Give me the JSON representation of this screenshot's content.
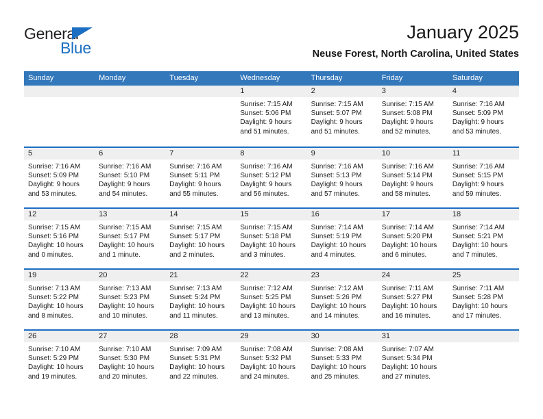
{
  "brand": {
    "word_one": "General",
    "word_two": "Blue",
    "accent_color": "#1b6ec2"
  },
  "header": {
    "title": "January 2025",
    "location": "Neuse Forest, North Carolina, United States"
  },
  "calendar": {
    "header_bg": "#3478bc",
    "weekdays": [
      "Sunday",
      "Monday",
      "Tuesday",
      "Wednesday",
      "Thursday",
      "Friday",
      "Saturday"
    ],
    "weeks": [
      [
        {
          "day": "",
          "empty": true,
          "sunrise": "",
          "sunset": "",
          "daylight_line1": "",
          "daylight_line2": ""
        },
        {
          "day": "",
          "empty": true,
          "sunrise": "",
          "sunset": "",
          "daylight_line1": "",
          "daylight_line2": ""
        },
        {
          "day": "",
          "empty": true,
          "sunrise": "",
          "sunset": "",
          "daylight_line1": "",
          "daylight_line2": ""
        },
        {
          "day": "1",
          "sunrise": "Sunrise: 7:15 AM",
          "sunset": "Sunset: 5:06 PM",
          "daylight_line1": "Daylight: 9 hours",
          "daylight_line2": "and 51 minutes."
        },
        {
          "day": "2",
          "sunrise": "Sunrise: 7:15 AM",
          "sunset": "Sunset: 5:07 PM",
          "daylight_line1": "Daylight: 9 hours",
          "daylight_line2": "and 51 minutes."
        },
        {
          "day": "3",
          "sunrise": "Sunrise: 7:15 AM",
          "sunset": "Sunset: 5:08 PM",
          "daylight_line1": "Daylight: 9 hours",
          "daylight_line2": "and 52 minutes."
        },
        {
          "day": "4",
          "sunrise": "Sunrise: 7:16 AM",
          "sunset": "Sunset: 5:09 PM",
          "daylight_line1": "Daylight: 9 hours",
          "daylight_line2": "and 53 minutes."
        }
      ],
      [
        {
          "day": "5",
          "sunrise": "Sunrise: 7:16 AM",
          "sunset": "Sunset: 5:09 PM",
          "daylight_line1": "Daylight: 9 hours",
          "daylight_line2": "and 53 minutes."
        },
        {
          "day": "6",
          "sunrise": "Sunrise: 7:16 AM",
          "sunset": "Sunset: 5:10 PM",
          "daylight_line1": "Daylight: 9 hours",
          "daylight_line2": "and 54 minutes."
        },
        {
          "day": "7",
          "sunrise": "Sunrise: 7:16 AM",
          "sunset": "Sunset: 5:11 PM",
          "daylight_line1": "Daylight: 9 hours",
          "daylight_line2": "and 55 minutes."
        },
        {
          "day": "8",
          "sunrise": "Sunrise: 7:16 AM",
          "sunset": "Sunset: 5:12 PM",
          "daylight_line1": "Daylight: 9 hours",
          "daylight_line2": "and 56 minutes."
        },
        {
          "day": "9",
          "sunrise": "Sunrise: 7:16 AM",
          "sunset": "Sunset: 5:13 PM",
          "daylight_line1": "Daylight: 9 hours",
          "daylight_line2": "and 57 minutes."
        },
        {
          "day": "10",
          "sunrise": "Sunrise: 7:16 AM",
          "sunset": "Sunset: 5:14 PM",
          "daylight_line1": "Daylight: 9 hours",
          "daylight_line2": "and 58 minutes."
        },
        {
          "day": "11",
          "sunrise": "Sunrise: 7:16 AM",
          "sunset": "Sunset: 5:15 PM",
          "daylight_line1": "Daylight: 9 hours",
          "daylight_line2": "and 59 minutes."
        }
      ],
      [
        {
          "day": "12",
          "sunrise": "Sunrise: 7:15 AM",
          "sunset": "Sunset: 5:16 PM",
          "daylight_line1": "Daylight: 10 hours",
          "daylight_line2": "and 0 minutes."
        },
        {
          "day": "13",
          "sunrise": "Sunrise: 7:15 AM",
          "sunset": "Sunset: 5:17 PM",
          "daylight_line1": "Daylight: 10 hours",
          "daylight_line2": "and 1 minute."
        },
        {
          "day": "14",
          "sunrise": "Sunrise: 7:15 AM",
          "sunset": "Sunset: 5:17 PM",
          "daylight_line1": "Daylight: 10 hours",
          "daylight_line2": "and 2 minutes."
        },
        {
          "day": "15",
          "sunrise": "Sunrise: 7:15 AM",
          "sunset": "Sunset: 5:18 PM",
          "daylight_line1": "Daylight: 10 hours",
          "daylight_line2": "and 3 minutes."
        },
        {
          "day": "16",
          "sunrise": "Sunrise: 7:14 AM",
          "sunset": "Sunset: 5:19 PM",
          "daylight_line1": "Daylight: 10 hours",
          "daylight_line2": "and 4 minutes."
        },
        {
          "day": "17",
          "sunrise": "Sunrise: 7:14 AM",
          "sunset": "Sunset: 5:20 PM",
          "daylight_line1": "Daylight: 10 hours",
          "daylight_line2": "and 6 minutes."
        },
        {
          "day": "18",
          "sunrise": "Sunrise: 7:14 AM",
          "sunset": "Sunset: 5:21 PM",
          "daylight_line1": "Daylight: 10 hours",
          "daylight_line2": "and 7 minutes."
        }
      ],
      [
        {
          "day": "19",
          "sunrise": "Sunrise: 7:13 AM",
          "sunset": "Sunset: 5:22 PM",
          "daylight_line1": "Daylight: 10 hours",
          "daylight_line2": "and 8 minutes."
        },
        {
          "day": "20",
          "sunrise": "Sunrise: 7:13 AM",
          "sunset": "Sunset: 5:23 PM",
          "daylight_line1": "Daylight: 10 hours",
          "daylight_line2": "and 10 minutes."
        },
        {
          "day": "21",
          "sunrise": "Sunrise: 7:13 AM",
          "sunset": "Sunset: 5:24 PM",
          "daylight_line1": "Daylight: 10 hours",
          "daylight_line2": "and 11 minutes."
        },
        {
          "day": "22",
          "sunrise": "Sunrise: 7:12 AM",
          "sunset": "Sunset: 5:25 PM",
          "daylight_line1": "Daylight: 10 hours",
          "daylight_line2": "and 13 minutes."
        },
        {
          "day": "23",
          "sunrise": "Sunrise: 7:12 AM",
          "sunset": "Sunset: 5:26 PM",
          "daylight_line1": "Daylight: 10 hours",
          "daylight_line2": "and 14 minutes."
        },
        {
          "day": "24",
          "sunrise": "Sunrise: 7:11 AM",
          "sunset": "Sunset: 5:27 PM",
          "daylight_line1": "Daylight: 10 hours",
          "daylight_line2": "and 16 minutes."
        },
        {
          "day": "25",
          "sunrise": "Sunrise: 7:11 AM",
          "sunset": "Sunset: 5:28 PM",
          "daylight_line1": "Daylight: 10 hours",
          "daylight_line2": "and 17 minutes."
        }
      ],
      [
        {
          "day": "26",
          "sunrise": "Sunrise: 7:10 AM",
          "sunset": "Sunset: 5:29 PM",
          "daylight_line1": "Daylight: 10 hours",
          "daylight_line2": "and 19 minutes."
        },
        {
          "day": "27",
          "sunrise": "Sunrise: 7:10 AM",
          "sunset": "Sunset: 5:30 PM",
          "daylight_line1": "Daylight: 10 hours",
          "daylight_line2": "and 20 minutes."
        },
        {
          "day": "28",
          "sunrise": "Sunrise: 7:09 AM",
          "sunset": "Sunset: 5:31 PM",
          "daylight_line1": "Daylight: 10 hours",
          "daylight_line2": "and 22 minutes."
        },
        {
          "day": "29",
          "sunrise": "Sunrise: 7:08 AM",
          "sunset": "Sunset: 5:32 PM",
          "daylight_line1": "Daylight: 10 hours",
          "daylight_line2": "and 24 minutes."
        },
        {
          "day": "30",
          "sunrise": "Sunrise: 7:08 AM",
          "sunset": "Sunset: 5:33 PM",
          "daylight_line1": "Daylight: 10 hours",
          "daylight_line2": "and 25 minutes."
        },
        {
          "day": "31",
          "sunrise": "Sunrise: 7:07 AM",
          "sunset": "Sunset: 5:34 PM",
          "daylight_line1": "Daylight: 10 hours",
          "daylight_line2": "and 27 minutes."
        },
        {
          "day": "",
          "empty": true,
          "sunrise": "",
          "sunset": "",
          "daylight_line1": "",
          "daylight_line2": ""
        }
      ]
    ]
  }
}
